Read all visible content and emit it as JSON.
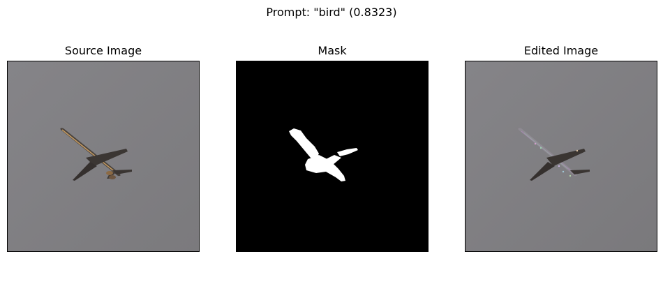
{
  "figure": {
    "suptitle": "Prompt: \"bird\" (0.8323)"
  },
  "panels": [
    {
      "title": "Source Image"
    },
    {
      "title": "Mask"
    },
    {
      "title": "Edited Image"
    }
  ],
  "colors": {
    "sky_gray": "#818083",
    "mask_background": "#000000",
    "mask_foreground": "#ffffff",
    "airplane_body": "#3a3532"
  }
}
